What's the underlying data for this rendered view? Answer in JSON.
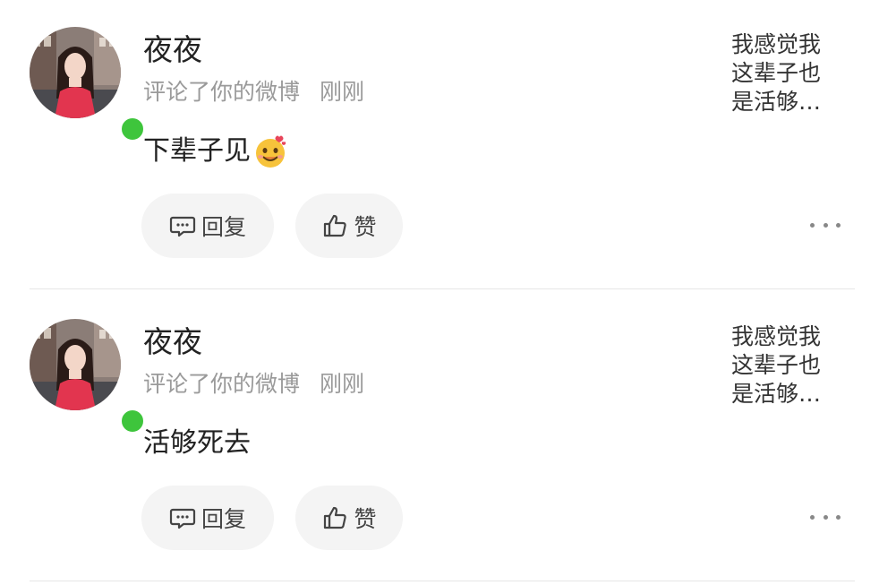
{
  "comments": [
    {
      "username": "夜夜",
      "action": "评论了你的微博",
      "time": "刚刚",
      "content": "下辈子见",
      "content_emoji": "smiling-face-with-hearts-emoji",
      "quote_lines": [
        "我感觉我",
        "这辈子也",
        "是活够…"
      ],
      "reply_label": "回复",
      "like_label": "赞",
      "online_status_color": "#3ec53c"
    },
    {
      "username": "夜夜",
      "action": "评论了你的微博",
      "time": "刚刚",
      "content": "活够死去",
      "content_emoji": "",
      "quote_lines": [
        "我感觉我",
        "这辈子也",
        "是活够…"
      ],
      "reply_label": "回复",
      "like_label": "赞",
      "online_status_color": "#3ec53c"
    }
  ],
  "icons": {
    "reply": "comment-bubble-icon",
    "like": "thumbs-up-icon",
    "more": "more-dots-icon"
  }
}
